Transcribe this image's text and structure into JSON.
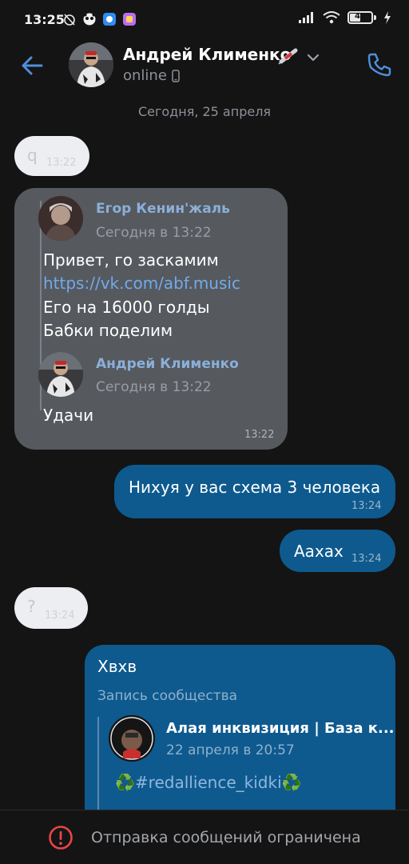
{
  "status_bar": {
    "time": "13:25",
    "battery": "45"
  },
  "header": {
    "name": "Андрей Клименко",
    "status": "online"
  },
  "date_separator": "Сегодня, 25 апреля",
  "messages": [
    {
      "text": "q",
      "time": "13:22"
    },
    {
      "time": "13:22",
      "forwarded": [
        {
          "author": "Егор Кенин'жаль",
          "date": "Сегодня в 13:22",
          "lines": [
            "Привет, го заскамим",
            "https://vk.com/abf.music",
            "Его на 16000 голды",
            "Бабки поделим"
          ]
        },
        {
          "author": "Андрей Клименко",
          "date": "Сегодня в 13:22",
          "lines": [
            "Удачи"
          ]
        }
      ]
    },
    {
      "text": "Нихуя у вас схема 3 человека",
      "time": "13:24"
    },
    {
      "text": "Аахах",
      "time": "13:24"
    },
    {
      "text": "?",
      "time": "13:24"
    },
    {
      "text": "Хвхв",
      "repost_label": "Запись сообщества",
      "repost": {
        "author": "Алая инквизиция | База к...",
        "date": "22 апреля в 20:57",
        "hashtag": "♻️#redallience_kidki♻️"
      }
    }
  ],
  "bottom": {
    "restricted": "Отправка сообщений ограничена"
  },
  "colors": {
    "accent": "#4e8fdc",
    "outgoing_bubble": "#0e5a8e",
    "incoming_bubble": "#56595e",
    "warning": "#e64646"
  },
  "icons": [
    "back-arrow-icon",
    "chevron-down-icon",
    "phone-icon",
    "phone-device-icon",
    "warning-icon"
  ]
}
